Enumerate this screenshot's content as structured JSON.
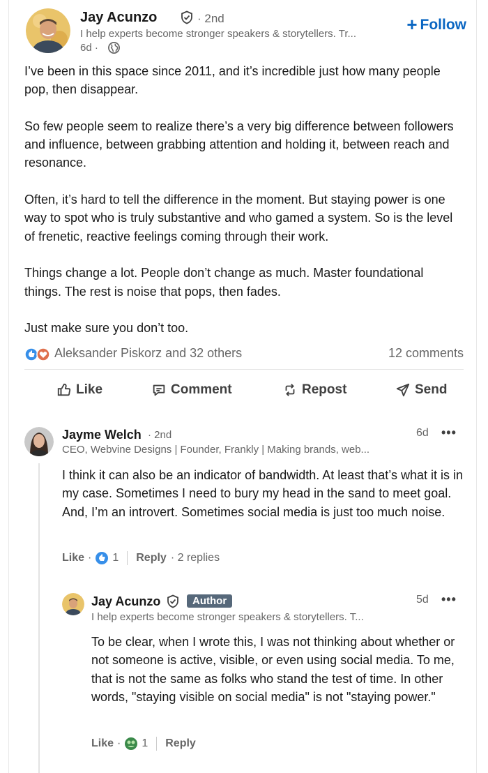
{
  "post": {
    "author_name": "Jay Acunzo",
    "degree": "· 2nd",
    "headline": "I help experts become stronger speakers & storytellers. Tr...",
    "time": "6d ·",
    "follow_label": "Follow",
    "body": [
      "I’ve been in this space since 2011, and it’s incredible just how many people pop, then disappear.",
      "So few people seem to realize there’s a very big difference between followers and influence, between grabbing attention and holding it, between reach and resonance.",
      "Often, it’s hard to tell the difference in the moment. But staying power is one way to spot who is truly substantive and who gamed a system. So is the level of frenetic, reactive feelings coming through their work.",
      "Things change a lot. People don’t change as much. Master foundational things. The rest is noise that pops, then fades.",
      "Just make sure you don’t too."
    ],
    "reactions_text": "Aleksander Piskorz and 32 others",
    "comments_count": "12 comments"
  },
  "actions": {
    "like": "Like",
    "comment": "Comment",
    "repost": "Repost",
    "send": "Send"
  },
  "comment1": {
    "name": "Jayme Welch",
    "degree": "· 2nd",
    "headline": "CEO, Webvine Designs | Founder, Frankly | Making brands, web...",
    "time": "6d",
    "more": "•••",
    "text": "I think it can also be an indicator of bandwidth. At least that’s what it is in my case. Sometimes I need to bury my head in the sand to meet goal. And, I’m an introvert. Sometimes social media is just too much noise.",
    "like_label": "Like",
    "dot": "·",
    "like_count": "1",
    "reply_label": "Reply",
    "replies": "· 2 replies"
  },
  "reply1": {
    "name": "Jay Acunzo",
    "badge": "Author",
    "headline": "I help experts become stronger speakers & storytellers. T...",
    "time": "5d",
    "more": "•••",
    "text": "To be clear, when I wrote this, I was not thinking about whether or not someone is active, visible, or even using social media. To me, that is not the same as folks who stand the test of time. In other words, \"staying visible on social media\" is not \"staying power.\"",
    "like_label": "Like",
    "dot": "·",
    "like_count": "1",
    "reply_label": "Reply"
  },
  "colors": {
    "link_blue": "#0a66c2",
    "text": "#191919",
    "muted": "#666666",
    "author_badge": "#56687a"
  }
}
